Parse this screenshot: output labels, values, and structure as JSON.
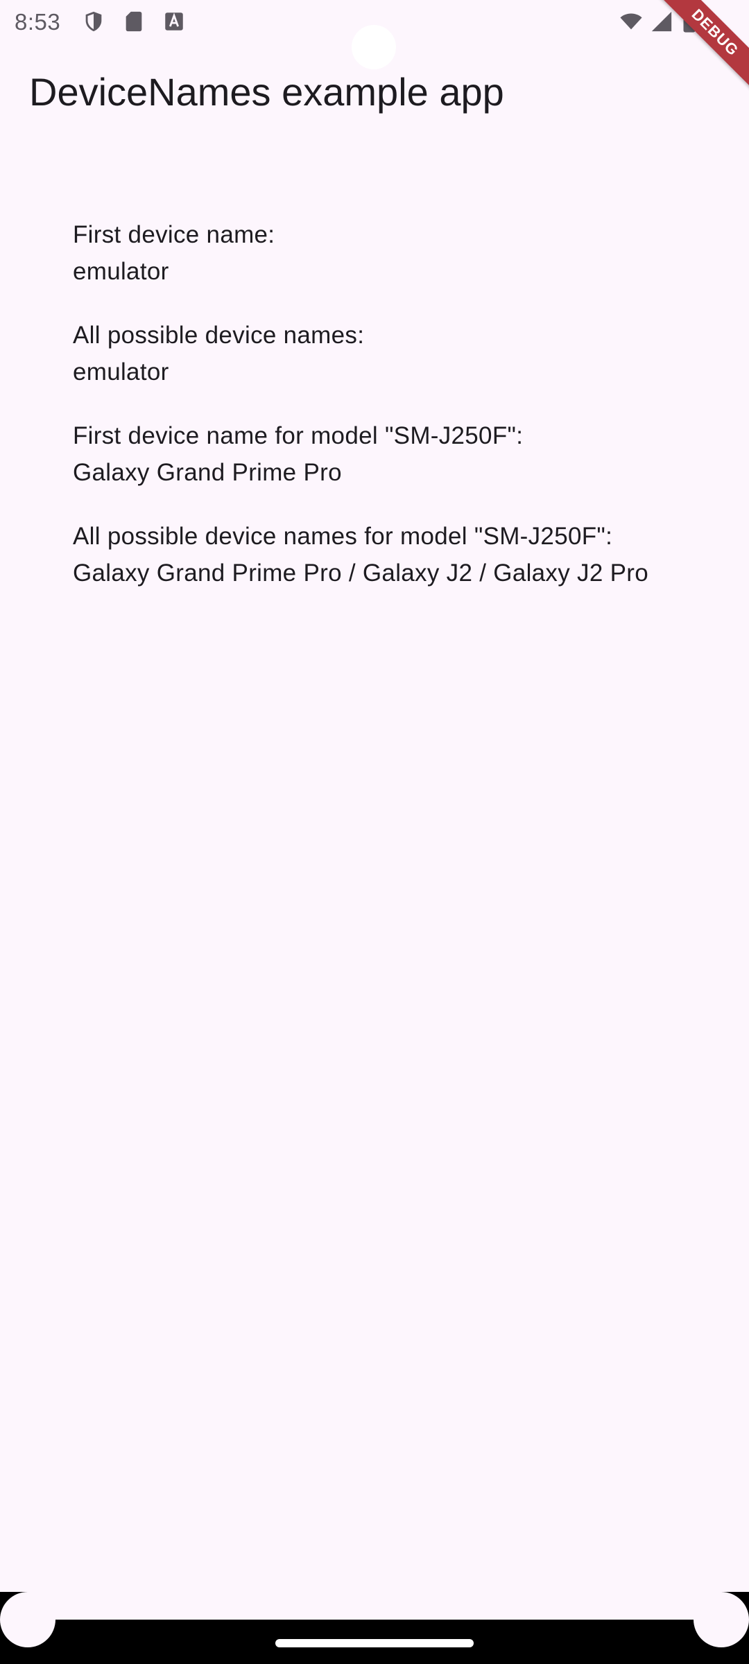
{
  "status_bar": {
    "time": "8:53",
    "icons": [
      "shield-icon",
      "sd-card-icon",
      "keyboard-a-icon",
      "wifi-icon",
      "cellular-signal-icon",
      "battery-icon"
    ]
  },
  "debug_banner": {
    "label": "DEBUG",
    "color": "#b3383f"
  },
  "app_bar": {
    "title": "DeviceNames example app"
  },
  "content": {
    "blocks": [
      {
        "label": "First device name:",
        "value": "emulator"
      },
      {
        "label": "All possible device names:",
        "value": "emulator"
      },
      {
        "label": "First device name for model \"SM-J250F\":",
        "value": "Galaxy Grand Prime Pro"
      },
      {
        "label": "All possible device names for model \"SM-J250F\":",
        "value": "Galaxy Grand Prime Pro / Galaxy J2 / Galaxy J2 Pro"
      }
    ]
  },
  "colors": {
    "background": "#fdf6fd",
    "text": "#1d1b20",
    "status_text": "#5e5a62"
  }
}
